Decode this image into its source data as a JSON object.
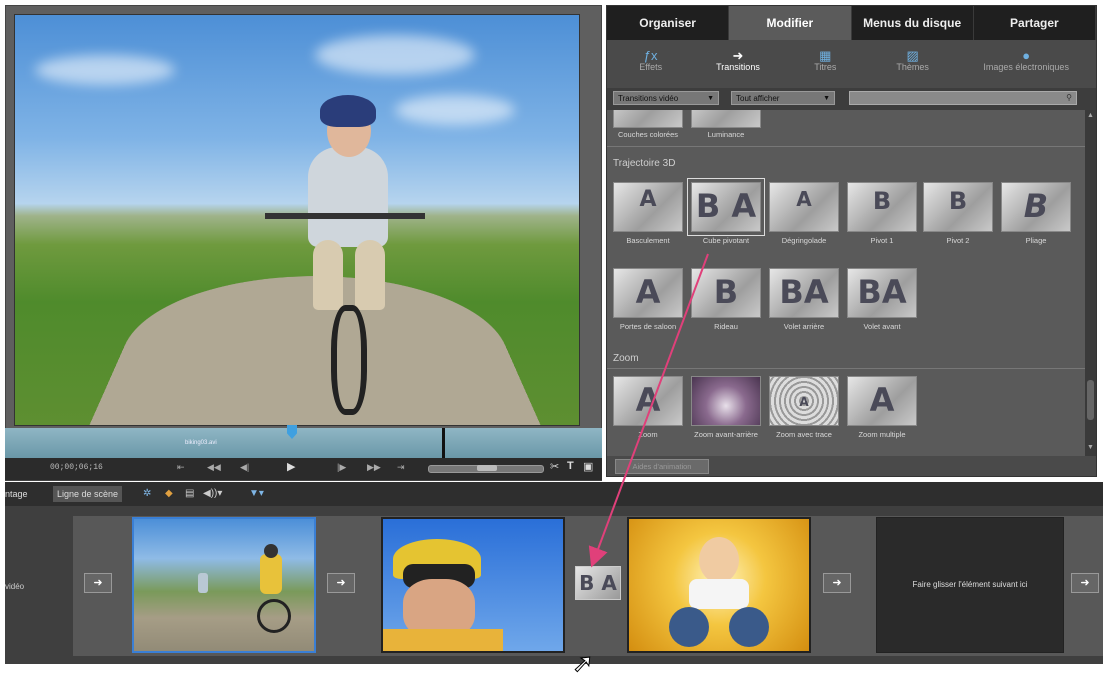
{
  "task_panel": {
    "tabs": [
      {
        "label": "Organiser"
      },
      {
        "label": "Modifier"
      },
      {
        "label": "Menus du disque"
      },
      {
        "label": "Partager"
      }
    ],
    "subtabs": [
      {
        "label": "Effets",
        "icon": "effects-icon"
      },
      {
        "label": "Transitions",
        "icon": "transitions-icon"
      },
      {
        "label": "Titres",
        "icon": "titles-icon"
      },
      {
        "label": "Thèmes",
        "icon": "themes-icon"
      },
      {
        "label": "Images électroniques",
        "icon": "clip-art-icon"
      }
    ],
    "filter": {
      "category": "Transitions vidéo",
      "show": "Tout afficher",
      "search_value": ""
    },
    "top_row_labels": [
      "Couches colorées",
      "Luminance"
    ],
    "sections": [
      {
        "title": "Trajectoire 3D",
        "items": [
          {
            "label": "Basculement",
            "glyph": "A"
          },
          {
            "label": "Cube pivotant",
            "glyph": "B A"
          },
          {
            "label": "Dégringolade",
            "glyph": "A"
          },
          {
            "label": "Pivot 1",
            "glyph": "B"
          },
          {
            "label": "Pivot 2",
            "glyph": "B"
          },
          {
            "label": "Pliage",
            "glyph": "B"
          },
          {
            "label": "Portes de saloon",
            "glyph": "A"
          },
          {
            "label": "Rideau",
            "glyph": "B"
          },
          {
            "label": "Volet arrière",
            "glyph": "BA"
          },
          {
            "label": "Volet avant",
            "glyph": "BA"
          }
        ]
      },
      {
        "title": "Zoom",
        "items": [
          {
            "label": "Zoom",
            "glyph": "A"
          },
          {
            "label": "Zoom avant-arrière",
            "glyph": "A"
          },
          {
            "label": "Zoom avec trace",
            "glyph": "A"
          },
          {
            "label": "Zoom multiple",
            "glyph": "A"
          }
        ]
      }
    ],
    "footer_button": "Aides d'animation"
  },
  "monitor": {
    "clip_name": "biking03.avi",
    "timecode": "00;00;06;16"
  },
  "storyboard": {
    "tabs": [
      "ntage",
      "Ligne de scène"
    ],
    "lane_label": "vidéo",
    "drop_zone_text": "Faire glisser l'élément suivant ici",
    "transition_glyph": "B A"
  },
  "colors": {
    "selection_blue": "#3a7fd5",
    "arrow_pink": "#e0407a"
  }
}
